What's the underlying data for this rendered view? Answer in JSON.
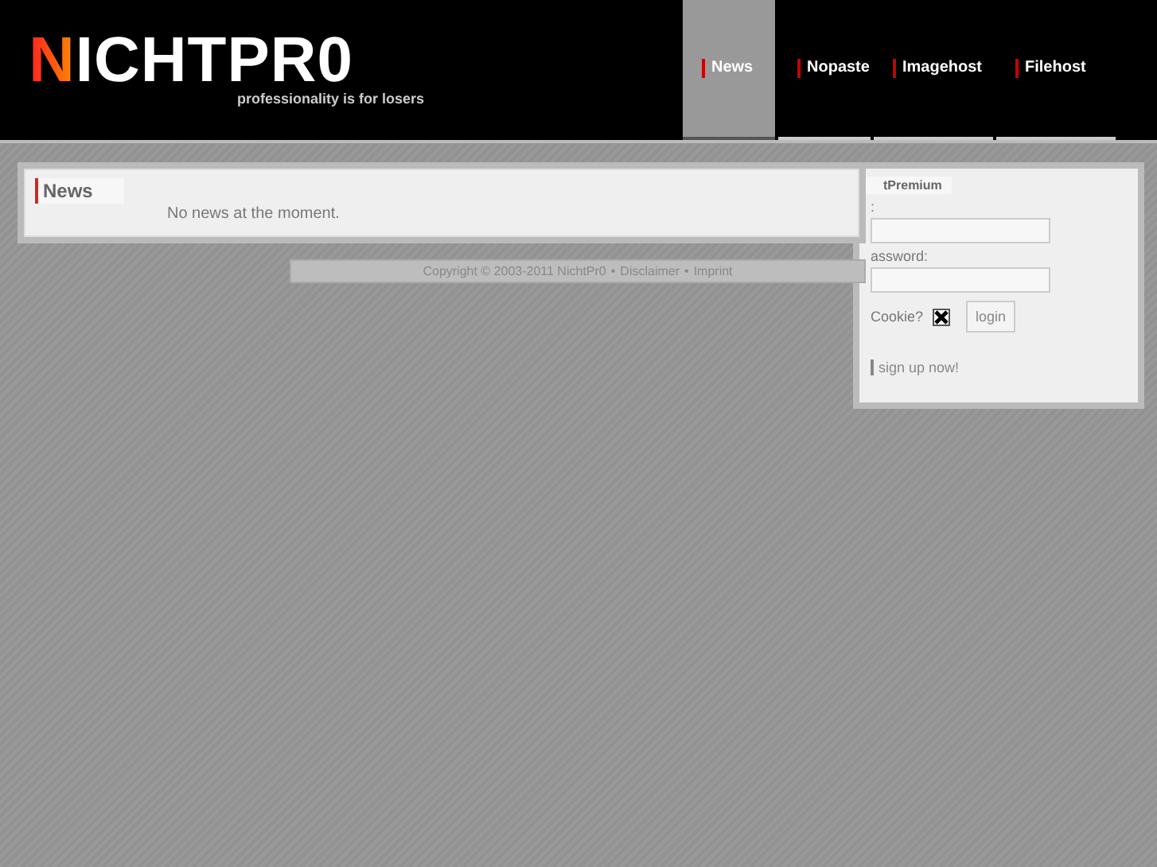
{
  "logo": {
    "first_letter": "N",
    "rest": "ICHTPR0",
    "tagline": "professionality is for losers"
  },
  "tabs": [
    {
      "label": "News",
      "selected": true
    },
    {
      "label": "Nopaste",
      "selected": false
    },
    {
      "label": "Imagehost",
      "selected": false
    },
    {
      "label": "Filehost",
      "selected": false
    }
  ],
  "news": {
    "title": "News",
    "message": "No news at the moment."
  },
  "footer": {
    "copyright": "Copyright © 2003-2011 NichtPr0",
    "separator_1": "•",
    "disclaimer": "Disclaimer",
    "separator_2": "•",
    "imprint": "Imprint"
  },
  "login": {
    "title": "tPremium",
    "user_label": ":",
    "password_label": "assword:",
    "cookie_label": "Cookie?",
    "cookie_checked": true,
    "button": "login",
    "signup": "sign up now!"
  }
}
